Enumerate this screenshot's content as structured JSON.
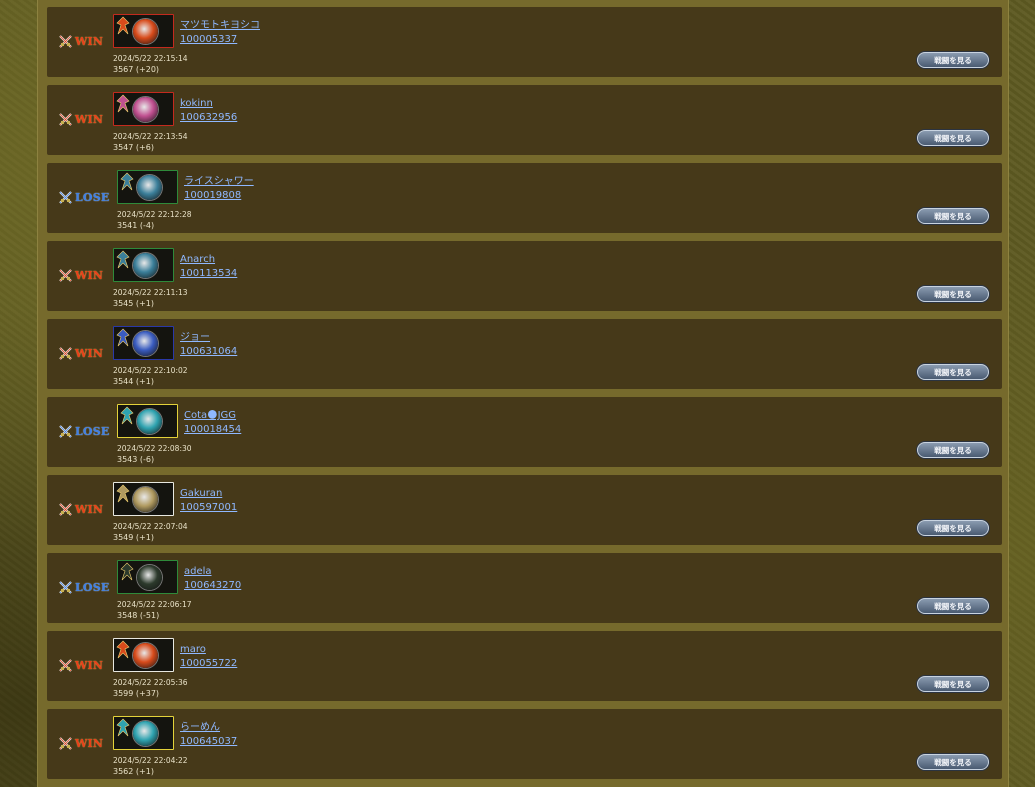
{
  "watch_label": "戦闘を見る",
  "colors": {
    "win": "#e8401a",
    "lose": "#3f7fe6",
    "link": "#8fb8ff",
    "row_bg": "#463919",
    "panel_bg": "#766a2c"
  },
  "matches": [
    {
      "result": "WIN",
      "name": "マツモトキヨシコ",
      "player_id": "100005337",
      "timestamp": "2024/5/22 22:15:14",
      "rating": "3567 (+20)",
      "frame_color": "#c42a1e",
      "portrait_icon": "armored-knight-icon",
      "rune_color": "#d84b1b"
    },
    {
      "result": "WIN",
      "name": "kokinn",
      "player_id": "100632956",
      "timestamp": "2024/5/22 22:13:54",
      "rating": "3547 (+6)",
      "frame_color": "#c42a1e",
      "portrait_icon": "white-haired-character-icon",
      "rune_color": "#c05090"
    },
    {
      "result": "LOSE",
      "name": "ライスシャワー",
      "player_id": "100019808",
      "timestamp": "2024/5/22 22:12:28",
      "rating": "3541 (-4)",
      "frame_color": "#2e8a3a",
      "portrait_icon": "dark-warrior-icon",
      "rune_color": "#3b7f9a"
    },
    {
      "result": "WIN",
      "name": "Anarch",
      "player_id": "100113534",
      "timestamp": "2024/5/22 22:11:13",
      "rating": "3545 (+1)",
      "frame_color": "#2e8a3a",
      "portrait_icon": "shadow-beast-icon",
      "rune_color": "#3b7f9a"
    },
    {
      "result": "WIN",
      "name": "ジョー",
      "player_id": "100631064",
      "timestamp": "2024/5/22 22:10:02",
      "rating": "3544 (+1)",
      "frame_color": "#2a38a8",
      "portrait_icon": "flame-orb-icon",
      "rune_color": "#3a5cc0"
    },
    {
      "result": "LOSE",
      "name": "Cota🌑JGG",
      "player_id": "100018454",
      "timestamp": "2024/5/22 22:08:30",
      "rating": "3543 (-6)",
      "frame_color": "#e3d23a",
      "portrait_icon": "robot-mage-icon",
      "rune_color": "#2fa3b0"
    },
    {
      "result": "WIN",
      "name": "Gakuran",
      "player_id": "100597001",
      "timestamp": "2024/5/22 22:07:04",
      "rating": "3549 (+1)",
      "frame_color": "#e8e8e0",
      "portrait_icon": "claw-slash-icon",
      "rune_color": "#b09a60"
    },
    {
      "result": "LOSE",
      "name": "adela",
      "player_id": "100643270",
      "timestamp": "2024/5/22 22:06:17",
      "rating": "3548 (-51)",
      "frame_color": "#2e8a3a",
      "portrait_icon": "snow-spirit-icon",
      "rune_color": "#2c3a2c"
    },
    {
      "result": "WIN",
      "name": "maro",
      "player_id": "100055722",
      "timestamp": "2024/5/22 22:05:36",
      "rating": "3599 (+37)",
      "frame_color": "#e8e8e0",
      "portrait_icon": "silver-knight-icon",
      "rune_color": "#d84b1b"
    },
    {
      "result": "WIN",
      "name": "らーめん",
      "player_id": "100645037",
      "timestamp": "2024/5/22 22:04:22",
      "rating": "3562 (+1)",
      "frame_color": "#e3d23a",
      "portrait_icon": "cute-blob-icon",
      "rune_color": "#2fa3b0"
    }
  ]
}
